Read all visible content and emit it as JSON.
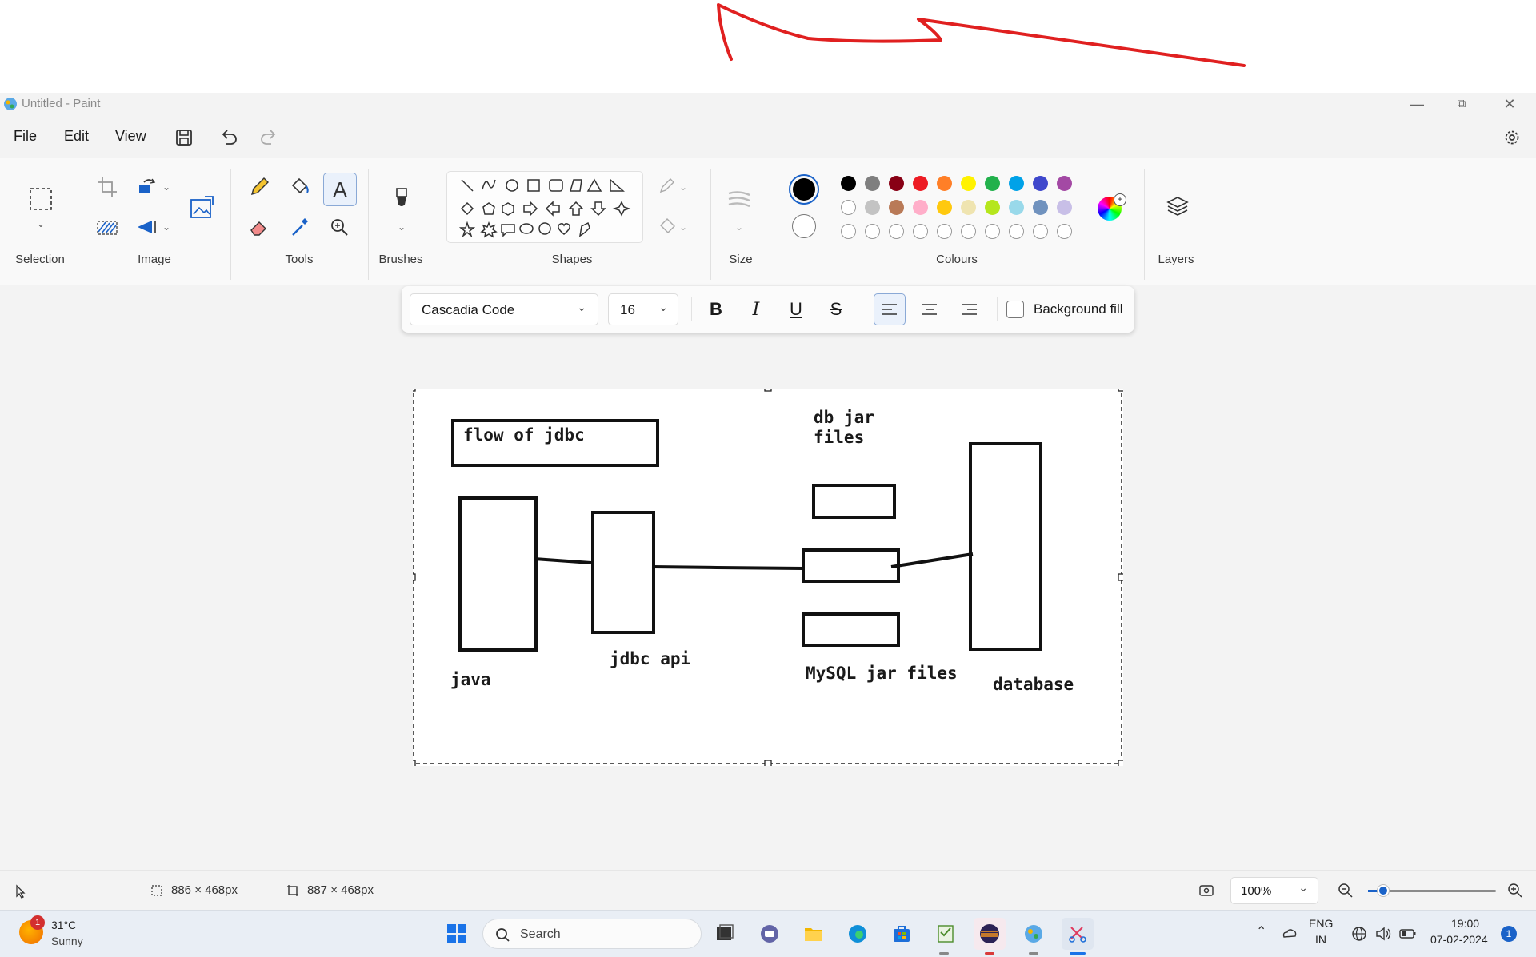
{
  "window": {
    "title": "Untitled - Paint"
  },
  "menu": {
    "file": "File",
    "edit": "Edit",
    "view": "View"
  },
  "ribbon": {
    "groups": {
      "selection": "Selection",
      "image": "Image",
      "tools": "Tools",
      "brushes": "Brushes",
      "shapes": "Shapes",
      "size": "Size",
      "colours": "Colours",
      "layers": "Layers"
    },
    "colours": {
      "primary": "#000000",
      "secondary": "#ffffff",
      "row1": [
        "#000000",
        "#7f7f7f",
        "#880015",
        "#ed1c24",
        "#ff7f27",
        "#fff200",
        "#22b14c",
        "#00a2e8",
        "#3f48cc",
        "#a349a4"
      ],
      "row2": [
        "#ffffff",
        "#c3c3c3",
        "#b97a57",
        "#ffaec9",
        "#ffc90e",
        "#efe4b0",
        "#b5e61d",
        "#99d9ea",
        "#7092be",
        "#c8bfe7"
      ]
    }
  },
  "text_toolbar": {
    "font": "Cascadia Code",
    "size": "16",
    "bold_label": "B",
    "italic_label": "I",
    "underline_label": "U",
    "strike_label": "S",
    "background_fill_label": "Background fill"
  },
  "canvas": {
    "title_box_text": "flow of jdbc",
    "db_jar_files_label": "db jar\nfiles",
    "java_label": "java",
    "jdbc_api_label": "jdbc api",
    "mysql_label": "MySQL jar files",
    "database_label": "database"
  },
  "status": {
    "selection_size": "886 × 468px",
    "canvas_size": "887 × 468px",
    "zoom": "100%"
  },
  "taskbar": {
    "weather_temp": "31°C",
    "weather_desc": "Sunny",
    "weather_badge": "1",
    "search_placeholder": "Search",
    "lang_line1": "ENG",
    "lang_line2": "IN",
    "time": "19:00",
    "date": "07-02-2024",
    "notification_count": "1"
  }
}
